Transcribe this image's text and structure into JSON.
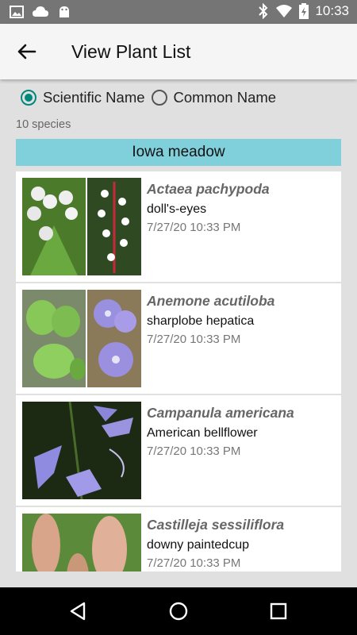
{
  "status_bar": {
    "time": "10:33"
  },
  "app_bar": {
    "title": "View Plant List"
  },
  "sort_options": [
    {
      "label": "Scientific Name",
      "selected": true
    },
    {
      "label": "Common Name",
      "selected": false
    }
  ],
  "species_count": "10 species",
  "list_name": "Iowa meadow",
  "plants": [
    {
      "scientific_name": "Actaea pachypoda",
      "common_name": "doll's-eyes",
      "date": "7/27/20 10:33 PM"
    },
    {
      "scientific_name": "Anemone acutiloba",
      "common_name": "sharplobe hepatica",
      "date": "7/27/20 10:33 PM"
    },
    {
      "scientific_name": "Campanula americana",
      "common_name": "American bellflower",
      "date": "7/27/20 10:33 PM"
    },
    {
      "scientific_name": "Castilleja sessiliflora",
      "common_name": "downy paintedcup",
      "date": "7/27/20 10:33 PM"
    }
  ],
  "colors": {
    "accent": "#00897b",
    "banner": "#80d0dc",
    "status_bar": "#757575"
  },
  "icons": [
    "image-icon",
    "cloud-icon",
    "android-icon",
    "bluetooth-icon",
    "wifi-icon",
    "battery-icon",
    "back-arrow-icon",
    "nav-back-icon",
    "nav-home-icon",
    "nav-recents-icon"
  ]
}
